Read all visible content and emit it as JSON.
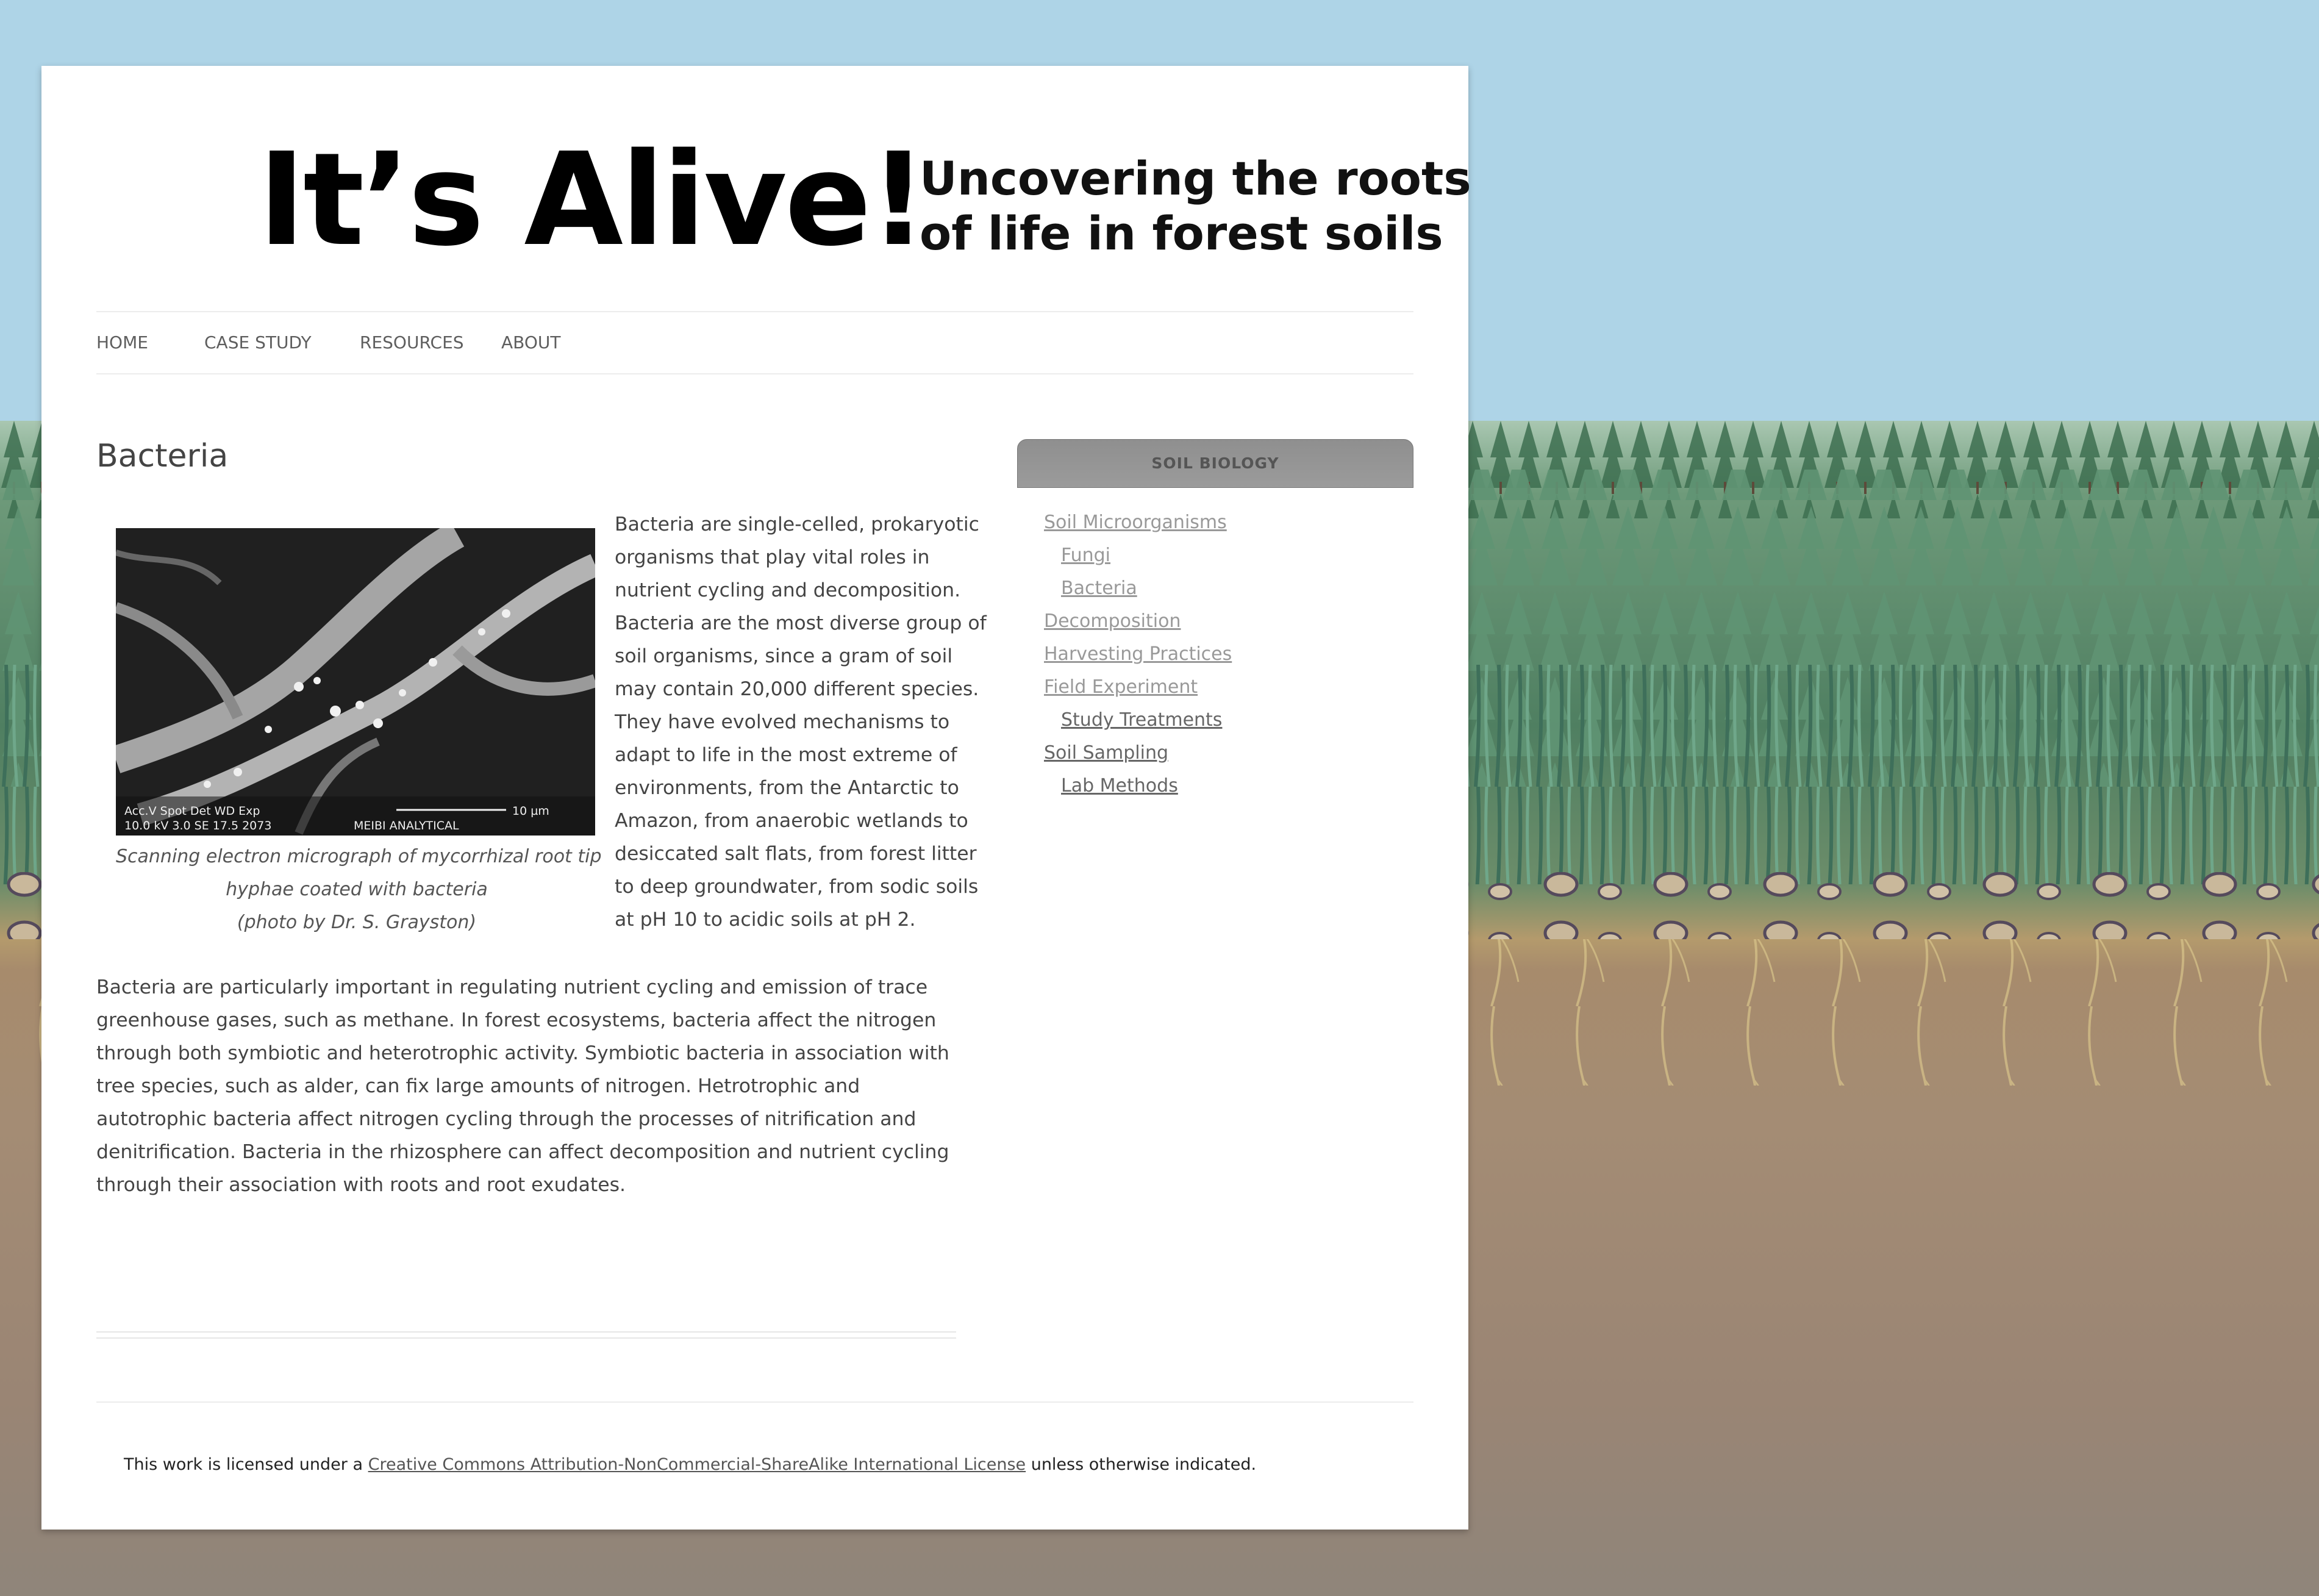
{
  "site": {
    "title": "It’s Alive!",
    "tagline_line1": "Uncovering the roots",
    "tagline_line2": "of life in forest soils"
  },
  "nav": [
    {
      "label": "HOME"
    },
    {
      "label": "CASE STUDY"
    },
    {
      "label": "RESOURCES"
    },
    {
      "label": "ABOUT"
    }
  ],
  "article": {
    "title": "Bacteria",
    "image_caption_line1": "Scanning electron micrograph of mycorrhizal root tip",
    "image_caption_line2": "hyphae coated with bacteria",
    "image_caption_line3": "(photo by Dr. S. Grayston)",
    "image_scale_text": "Acc.V  Spot Det  WD  Exp",
    "image_scale_text2": "10.0 kV 3.0   SE   17.5  2073",
    "image_scale_label": "10 µm",
    "image_lab_label": "MEIBI ANALYTICAL",
    "paragraph1": "Bacteria are single-celled, prokaryotic organisms that play vital roles in nutrient cycling and decomposition. Bacteria are the most diverse group of soil organisms, since a gram of soil may contain 20,000 different species. They have evolved mechanisms to adapt to life in the most extreme of environments, from the Antarctic to Amazon, from anaerobic wetlands to desiccated salt flats, from forest litter to deep groundwater, from sodic soils at pH 10 to acidic soils at pH 2.",
    "paragraph2": "Bacteria are particularly important in regulating nutrient cycling and emission of trace greenhouse gases, such as methane.  In forest ecosystems, bacteria affect the nitrogen through both symbiotic and heterotrophic activity. Symbiotic bacteria in association with tree species, such as alder, can fix large amounts of nitrogen. Hetrotrophic and autotrophic bacteria affect nitrogen cycling through the processes of nitrification and denitrification. Bacteria in the rhizosphere can affect decomposition and nutrient cycling through their association with roots and root exudates."
  },
  "sidebar": {
    "widget_title": "SOIL BIOLOGY",
    "items": [
      {
        "label": "Soil Microorganisms"
      },
      {
        "label": "Fungi"
      },
      {
        "label": "Bacteria"
      },
      {
        "label": "Decomposition"
      },
      {
        "label": "Harvesting Practices"
      },
      {
        "label": "Field Experiment"
      },
      {
        "label": "Study Treatments"
      },
      {
        "label": "Soil Sampling"
      },
      {
        "label": "Lab Methods"
      }
    ]
  },
  "footer": {
    "prefix": "This work is licensed under a ",
    "link": "Creative Commons Attribution-NonCommercial-ShareAlike International License",
    "suffix": " unless otherwise indicated."
  },
  "colors": {
    "sky": "#aed4e7",
    "link_light": "#999999",
    "link_dark": "#666666",
    "widget_header": "#959595"
  }
}
